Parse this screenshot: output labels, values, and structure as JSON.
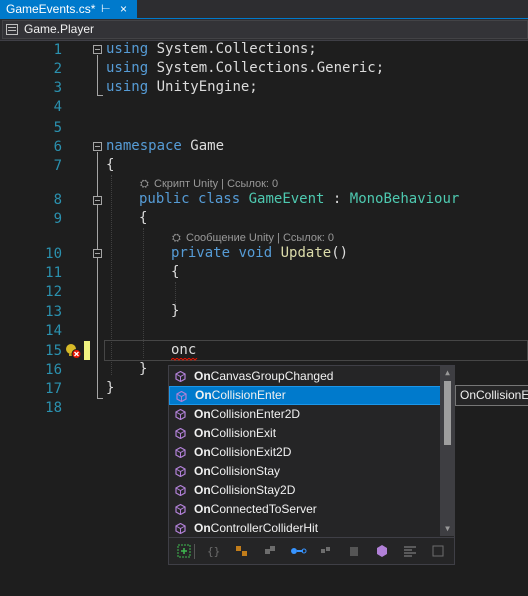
{
  "tab": {
    "title": "GameEvents.cs*",
    "pin_glyph": "⊢",
    "close_glyph": "×",
    "accent": "#007acc"
  },
  "navbar": {
    "project": "Game.Player"
  },
  "editor": {
    "line_numbers": [
      "1",
      "2",
      "3",
      "4",
      "5",
      "6",
      "7",
      "8",
      "9",
      "10",
      "11",
      "12",
      "13",
      "14",
      "15",
      "16",
      "17",
      "18"
    ],
    "lines": [
      {
        "kw": "using",
        "text": " System.Collections;"
      },
      {
        "kw": "using",
        "text": " System.Collections.Generic;"
      },
      {
        "kw": "using",
        "text": " UnityEngine;"
      },
      {
        "kw": "namespace",
        "text": " Game"
      },
      {
        "text": "{"
      },
      {
        "kw1": "public",
        "kw2": "class",
        "type": "GameEvent",
        "sep": " : ",
        "base": "MonoBehaviour"
      },
      {
        "text": "{"
      },
      {
        "kw1": "private",
        "kw2": "void",
        "method": "Update",
        "tail": "()"
      },
      {
        "text": "{"
      },
      {
        "text": "}"
      },
      {
        "text": "onc"
      },
      {
        "text": "}"
      },
      {
        "text": "}"
      }
    ],
    "codelens": {
      "class_lens": "Скрипт Unity | Ссылок: 0",
      "method_lens": "Сообщение Unity | Ссылок: 0"
    }
  },
  "completion": {
    "typed_prefix": "On",
    "items": [
      {
        "match": "On",
        "rest": "CanvasGroupChanged"
      },
      {
        "match": "On",
        "rest": "CollisionEnter"
      },
      {
        "match": "On",
        "rest": "CollisionEnter2D"
      },
      {
        "match": "On",
        "rest": "CollisionExit"
      },
      {
        "match": "On",
        "rest": "CollisionExit2D"
      },
      {
        "match": "On",
        "rest": "CollisionStay"
      },
      {
        "match": "On",
        "rest": "CollisionStay2D"
      },
      {
        "match": "On",
        "rest": "ConnectedToServer"
      },
      {
        "match": "On",
        "rest": "ControllerColliderHit"
      }
    ],
    "selected_index": 1,
    "tooltip": "OnCollisionEnter",
    "filters": [
      "expand-filter-icon",
      "braces-filter-icon",
      "members-filter-icon",
      "class-filter-icon",
      "property-filter-icon",
      "struct-filter-icon",
      "namespace-filter-icon",
      "method-filter-icon",
      "enum-filter-icon",
      "field-filter-icon"
    ],
    "item_icon": "method-cube-icon"
  }
}
